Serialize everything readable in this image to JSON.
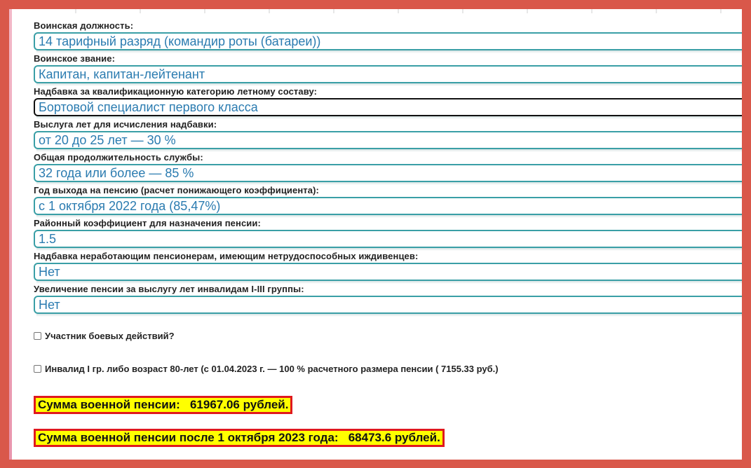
{
  "fields": [
    {
      "label": "Воинская должность:",
      "value": "14 тарифный разряд (командир роты (батареи))"
    },
    {
      "label": "Воинское звание:",
      "value": "Капитан, капитан-лейтенант"
    },
    {
      "label": "Надбавка за квалификационную категорию летному составу:",
      "value": "Бортовой специалист первого класса"
    },
    {
      "label": "Выслуга лет для исчисления надбавки:",
      "value": "от 20 до 25 лет — 30 %"
    },
    {
      "label": "Общая продолжительность службы:",
      "value": "32 года или более — 85 %"
    },
    {
      "label": "Год выхода на пенсию (расчет понижающего коэффициента):",
      "value": "с 1 октября 2022 года (85,47%)"
    },
    {
      "label": "Районный коэффициент для назначения пенсии:",
      "value": "1.5"
    },
    {
      "label": "Надбавка неработающим пенсионерам, имеющим нетрудоспособных иждивенцев:",
      "value": "Нет"
    },
    {
      "label": "Увеличение пенсии за выслугу лет инвалидам I-III группы:",
      "value": "Нет"
    }
  ],
  "checkboxes": [
    {
      "label": "Участник боевых действий?",
      "checked": false
    },
    {
      "label": "Инвалид I гр. либо возраст 80-лет (с 01.04.2023 г. — 100 % расчетного размера пенсии ( 7155.33 руб.)",
      "checked": false
    }
  ],
  "results": {
    "pension": "Сумма военной пенсии:   61967.06 рублей.",
    "pension_after": "Сумма военной пенсии после 1 октября 2023 года:   68473.6 рублей."
  },
  "colors": {
    "frame": "#d9584a",
    "select_border": "#3a9fa6",
    "select_text": "#2a7bb0",
    "result_bg": "#ffff00",
    "result_border": "#e0191e"
  }
}
